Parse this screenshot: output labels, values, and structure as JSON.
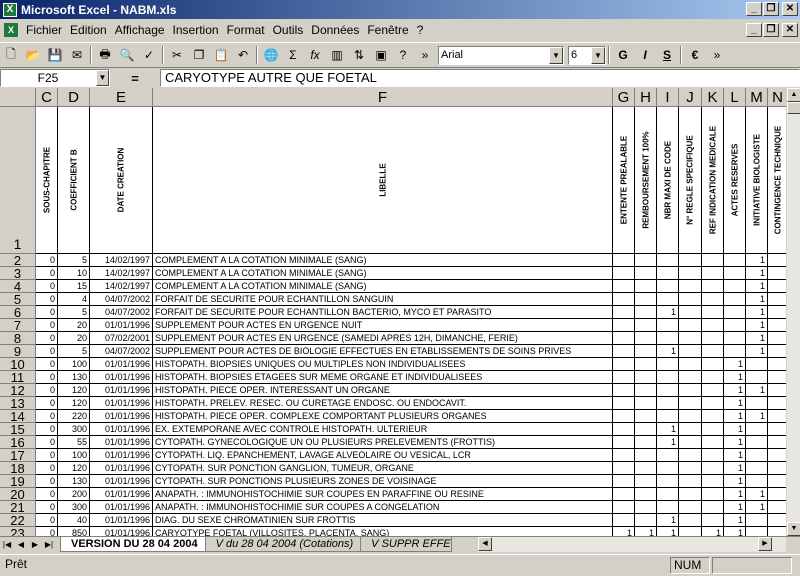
{
  "window": {
    "title": "Microsoft Excel - NABM.xls",
    "caption_min": "_",
    "caption_max": "❐",
    "caption_close": "✕"
  },
  "menu": [
    "Fichier",
    "Edition",
    "Affichage",
    "Insertion",
    "Format",
    "Outils",
    "Données",
    "Fenêtre",
    "?"
  ],
  "toolbar": {
    "font": "Arial",
    "size": "6",
    "bold": "G",
    "italic": "I",
    "underline": "S",
    "euro": "€",
    "sum": "Σ",
    "fx": "fx"
  },
  "formula": {
    "cell_ref": "F25",
    "eq": "=",
    "content": "CARYOTYPE AUTRE QUE FOETAL"
  },
  "columns": [
    "C",
    "D",
    "E",
    "F",
    "G",
    "H",
    "I",
    "J",
    "K",
    "L",
    "M",
    "N"
  ],
  "headers": {
    "C": "SOUS-CHAPITRE",
    "D": "COEFFICIENT B",
    "E": "DATE CREATION",
    "F": "LIBELLE",
    "G": "ENTENTE PREALABLE",
    "H": "REMBOURSEMENT 100%",
    "I": "NBR MAXI DE CODE",
    "J": "N° REGLE SPECIFIQUE",
    "K": "REF INDICATION MEDICALE",
    "L": "ACTES RESERVES",
    "M": "INITIATIVE BIOLOGISTE",
    "N": "CONTINGENCE TECHNIQUE"
  },
  "header_row_number": "1",
  "rows": [
    {
      "n": "2",
      "c": "0",
      "d": "5",
      "e": "14/02/1997",
      "f": "COMPLEMENT A LA COTATION MINIMALE (SANG)",
      "g": "",
      "h": "",
      "i": "",
      "j": "",
      "k": "",
      "l": "",
      "m": "1"
    },
    {
      "n": "3",
      "c": "0",
      "d": "10",
      "e": "14/02/1997",
      "f": "COMPLEMENT A LA COTATION MINIMALE (SANG)",
      "g": "",
      "h": "",
      "i": "",
      "j": "",
      "k": "",
      "l": "",
      "m": "1"
    },
    {
      "n": "4",
      "c": "0",
      "d": "15",
      "e": "14/02/1997",
      "f": "COMPLEMENT A LA COTATION MINIMALE (SANG)",
      "g": "",
      "h": "",
      "i": "",
      "j": "",
      "k": "",
      "l": "",
      "m": "1"
    },
    {
      "n": "5",
      "c": "0",
      "d": "4",
      "e": "04/07/2002",
      "f": "FORFAIT DE SECURITE POUR ECHANTILLON SANGUIN",
      "g": "",
      "h": "",
      "i": "",
      "j": "",
      "k": "",
      "l": "",
      "m": "1"
    },
    {
      "n": "6",
      "c": "0",
      "d": "5",
      "e": "04/07/2002",
      "f": "FORFAIT DE SECURITE POUR ECHANTILLON BACTERIO, MYCO ET PARASITO",
      "g": "",
      "h": "",
      "i": "1",
      "j": "",
      "k": "",
      "l": "",
      "m": "1"
    },
    {
      "n": "7",
      "c": "0",
      "d": "20",
      "e": "01/01/1996",
      "f": "SUPPLEMENT POUR ACTES EN URGENCE NUIT",
      "g": "",
      "h": "",
      "i": "",
      "j": "",
      "k": "",
      "l": "",
      "m": "1"
    },
    {
      "n": "8",
      "c": "0",
      "d": "20",
      "e": "07/02/2001",
      "f": "SUPPLEMENT POUR ACTES EN URGENCE (SAMEDI APRES 12H, DIMANCHE, FERIE)",
      "g": "",
      "h": "",
      "i": "",
      "j": "",
      "k": "",
      "l": "",
      "m": "1"
    },
    {
      "n": "9",
      "c": "0",
      "d": "5",
      "e": "04/07/2002",
      "f": "SUPPLEMENT POUR ACTES DE BIOLOGIE EFFECTUES EN ETABLISSEMENTS DE SOINS PRIVES",
      "g": "",
      "h": "",
      "i": "1",
      "j": "",
      "k": "",
      "l": "",
      "m": "1"
    },
    {
      "n": "10",
      "c": "0",
      "d": "100",
      "e": "01/01/1996",
      "f": "HISTOPATH. BIOPSIES UNIQUES OU MULTIPLES NON INDIVIDUALISEES",
      "g": "",
      "h": "",
      "i": "",
      "j": "",
      "k": "",
      "l": "1",
      "m": ""
    },
    {
      "n": "11",
      "c": "0",
      "d": "130",
      "e": "01/01/1996",
      "f": "HISTOPATH. BIOPSIES ETAGEES SUR MEME ORGANE ET INDIVIDUALISEES",
      "g": "",
      "h": "",
      "i": "",
      "j": "",
      "k": "",
      "l": "1",
      "m": ""
    },
    {
      "n": "12",
      "c": "0",
      "d": "120",
      "e": "01/01/1996",
      "f": "HISTOPATH. PIECE OPER. INTERESSANT UN ORGANE",
      "g": "",
      "h": "",
      "i": "",
      "j": "",
      "k": "",
      "l": "1",
      "m": "1"
    },
    {
      "n": "13",
      "c": "0",
      "d": "120",
      "e": "01/01/1996",
      "f": "HISTOPATH. PRELEV. RESEC. OU CURETAGE ENDOSC. OU ENDOCAVIT.",
      "g": "",
      "h": "",
      "i": "",
      "j": "",
      "k": "",
      "l": "1",
      "m": ""
    },
    {
      "n": "14",
      "c": "0",
      "d": "220",
      "e": "01/01/1996",
      "f": "HISTOPATH. PIECE OPER. COMPLEXE COMPORTANT PLUSIEURS ORGANES",
      "g": "",
      "h": "",
      "i": "",
      "j": "",
      "k": "",
      "l": "1",
      "m": "1"
    },
    {
      "n": "15",
      "c": "0",
      "d": "300",
      "e": "01/01/1996",
      "f": "EX. EXTEMPORANE AVEC CONTROLE HISTOPATH. ULTERIEUR",
      "g": "",
      "h": "",
      "i": "1",
      "j": "",
      "k": "",
      "l": "1",
      "m": ""
    },
    {
      "n": "16",
      "c": "0",
      "d": "55",
      "e": "01/01/1996",
      "f": "CYTOPATH. GYNECOLOGIQUE UN OU PLUSIEURS PRELEVEMENTS (FROTTIS)",
      "g": "",
      "h": "",
      "i": "1",
      "j": "",
      "k": "",
      "l": "1",
      "m": ""
    },
    {
      "n": "17",
      "c": "0",
      "d": "100",
      "e": "01/01/1996",
      "f": "CYTOPATH. LIQ. EPANCHEMENT, LAVAGE ALVEOLAIRE OU VESICAL, LCR",
      "g": "",
      "h": "",
      "i": "",
      "j": "",
      "k": "",
      "l": "1",
      "m": ""
    },
    {
      "n": "18",
      "c": "0",
      "d": "120",
      "e": "01/01/1996",
      "f": "CYTOPATH. SUR PONCTION GANGLION, TUMEUR, ORGANE",
      "g": "",
      "h": "",
      "i": "",
      "j": "",
      "k": "",
      "l": "1",
      "m": ""
    },
    {
      "n": "19",
      "c": "0",
      "d": "130",
      "e": "01/01/1996",
      "f": "CYTOPATH. SUR PONCTIONS PLUSIEURS ZONES DE VOISINAGE",
      "g": "",
      "h": "",
      "i": "",
      "j": "",
      "k": "",
      "l": "1",
      "m": ""
    },
    {
      "n": "20",
      "c": "0",
      "d": "200",
      "e": "01/01/1996",
      "f": "ANAPATH. : IMMUNOHISTOCHIMIE SUR COUPES EN PARAFFINE OU RESINE",
      "g": "",
      "h": "",
      "i": "",
      "j": "",
      "k": "",
      "l": "1",
      "m": "1"
    },
    {
      "n": "21",
      "c": "0",
      "d": "300",
      "e": "01/01/1996",
      "f": "ANAPATH. : IMMUNOHISTOCHIMIE SUR COUPES A CONGELATION",
      "g": "",
      "h": "",
      "i": "",
      "j": "",
      "k": "",
      "l": "1",
      "m": "1"
    },
    {
      "n": "22",
      "c": "0",
      "d": "40",
      "e": "01/01/1996",
      "f": "DIAG. DU SEXE CHROMATINIEN SUR FROTTIS",
      "g": "",
      "h": "",
      "i": "1",
      "j": "",
      "k": "",
      "l": "1",
      "m": ""
    },
    {
      "n": "23",
      "c": "0",
      "d": "850",
      "e": "01/01/1996",
      "f": "CARYOTYPE FOETAL (VILLOSITES, PLACENTA, SANG)",
      "g": "1",
      "h": "1",
      "i": "1",
      "j": "",
      "k": "1",
      "l": "1",
      "m": ""
    }
  ],
  "sheet_tabs": [
    "VERSION DU 28 04 2004",
    "V du 28 04 2004 (Cotations)",
    "V SUPPR EFFET A"
  ],
  "status": {
    "ready": "Prêt",
    "num": "NUM"
  }
}
